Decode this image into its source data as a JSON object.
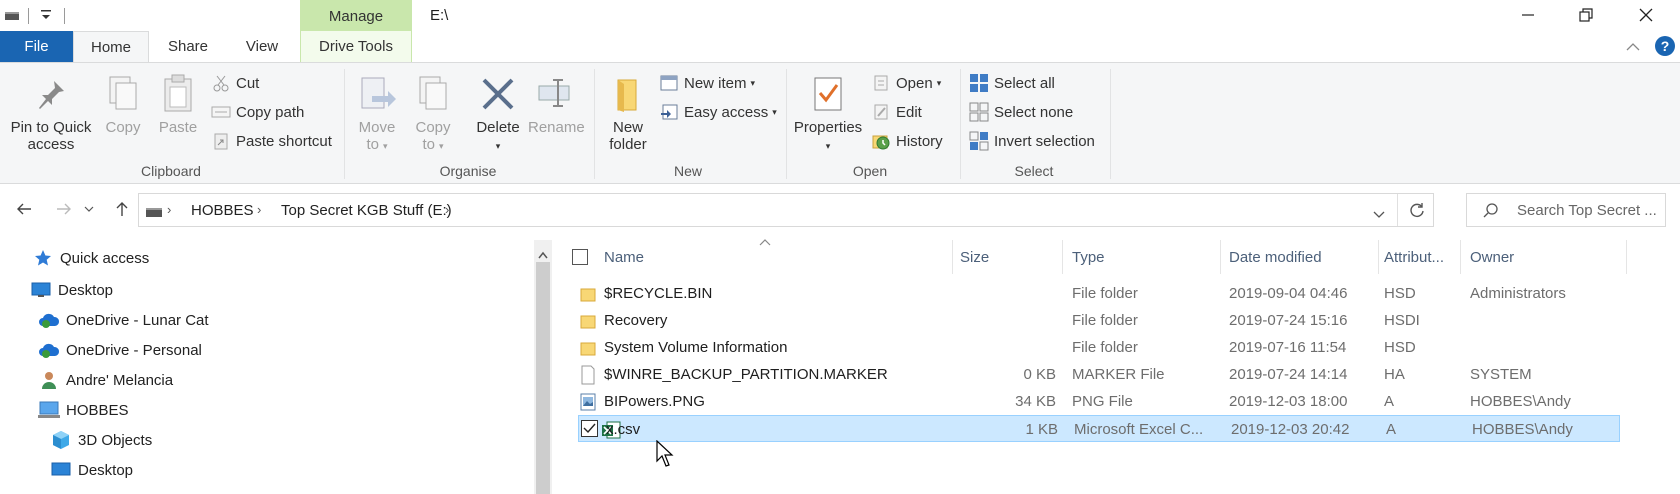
{
  "titlebar": {
    "manage_label": "Manage",
    "path": "E:\\"
  },
  "tabs": {
    "file": "File",
    "home": "Home",
    "share": "Share",
    "view": "View",
    "drive_tools": "Drive Tools"
  },
  "ribbon": {
    "clipboard": {
      "pin": "Pin to Quick access",
      "pin_l1": "Pin to Quick",
      "pin_l2": "access",
      "copy": "Copy",
      "paste": "Paste",
      "cut": "Cut",
      "copy_path": "Copy path",
      "paste_shortcut": "Paste shortcut",
      "label": "Clipboard"
    },
    "organise": {
      "move_l1": "Move",
      "move_l2": "to",
      "copy_l1": "Copy",
      "copy_l2": "to",
      "delete": "Delete",
      "rename": "Rename",
      "label": "Organise"
    },
    "new": {
      "folder_l1": "New",
      "folder_l2": "folder",
      "new_item": "New item",
      "easy_access": "Easy access",
      "label": "New"
    },
    "open": {
      "properties": "Properties",
      "open": "Open",
      "edit": "Edit",
      "history": "History",
      "label": "Open"
    },
    "select": {
      "select_all": "Select all",
      "select_none": "Select none",
      "invert": "Invert selection",
      "label": "Select"
    }
  },
  "address": {
    "crumbs": [
      "HOBBES",
      "Top Secret KGB Stuff (E:)"
    ],
    "search_placeholder": "Search Top Secret ..."
  },
  "nav": {
    "items": [
      {
        "label": "Quick access",
        "icon": "star-icon"
      },
      {
        "label": "Desktop",
        "icon": "desktop-icon"
      },
      {
        "label": "OneDrive - Lunar Cat",
        "icon": "cloud-icon"
      },
      {
        "label": "OneDrive - Personal",
        "icon": "cloud-icon"
      },
      {
        "label": "Andre' Melancia",
        "icon": "user-icon"
      },
      {
        "label": "HOBBES",
        "icon": "computer-icon"
      },
      {
        "label": "3D Objects",
        "icon": "cube-icon"
      },
      {
        "label": "Desktop",
        "icon": "desktop-icon"
      }
    ]
  },
  "columns": {
    "name": "Name",
    "size": "Size",
    "type": "Type",
    "date": "Date modified",
    "attr": "Attribut...",
    "owner": "Owner"
  },
  "files": [
    {
      "name": "$RECYCLE.BIN",
      "size": "",
      "type": "File folder",
      "date": "2019-09-04 04:46",
      "attr": "HSD",
      "owner": "Administrators",
      "icon": "folder-icon"
    },
    {
      "name": "Recovery",
      "size": "",
      "type": "File folder",
      "date": "2019-07-24 15:16",
      "attr": "HSDI",
      "owner": "",
      "icon": "folder-icon"
    },
    {
      "name": "System Volume Information",
      "size": "",
      "type": "File folder",
      "date": "2019-07-16 11:54",
      "attr": "HSD",
      "owner": "",
      "icon": "folder-icon"
    },
    {
      "name": "$WINRE_BACKUP_PARTITION.MARKER",
      "size": "0 KB",
      "type": "MARKER File",
      "date": "2019-07-24 14:14",
      "attr": "HA",
      "owner": "SYSTEM",
      "icon": "file-icon"
    },
    {
      "name": "BIPowers.PNG",
      "size": "34 KB",
      "type": "PNG File",
      "date": "2019-12-03 18:00",
      "attr": "A",
      "owner": "HOBBES\\Andy",
      "icon": "image-file-icon"
    },
    {
      "name": "x.csv",
      "size": "1 KB",
      "type": "Microsoft Excel C...",
      "date": "2019-12-03 20:42",
      "attr": "A",
      "owner": "HOBBES\\Andy",
      "icon": "excel-file-icon",
      "selected": true
    }
  ],
  "colors": {
    "file_tab": "#1a65b2",
    "manage_tab": "#c9e7ac",
    "selection": "#cce8ff",
    "folder": "#f8d775"
  }
}
